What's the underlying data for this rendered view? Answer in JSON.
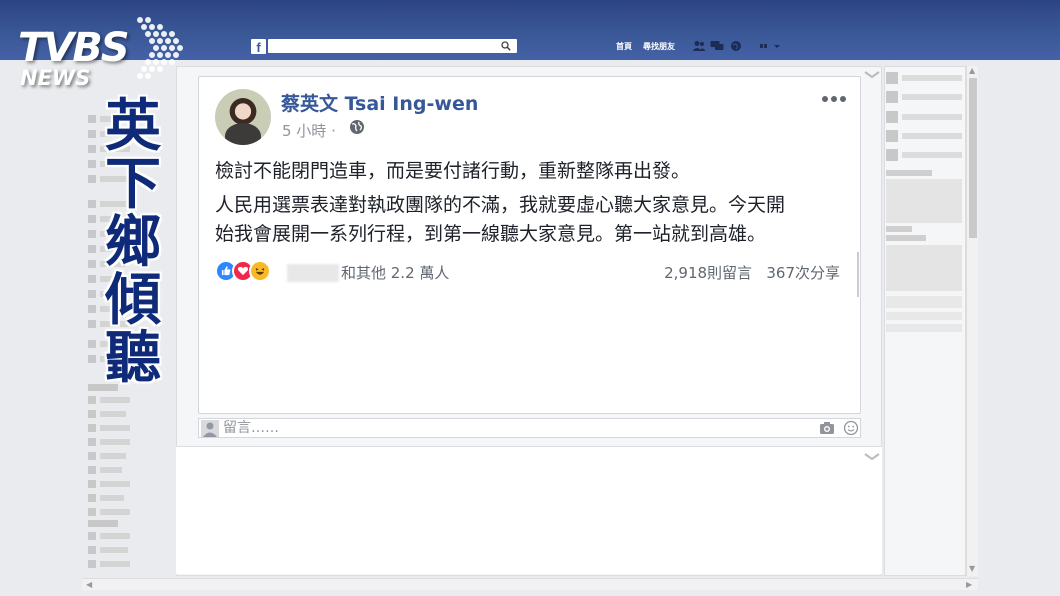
{
  "topbar": {
    "fb_logo": "f",
    "nav_home": "首頁",
    "nav_find_friends": "尋找朋友"
  },
  "overlay": {
    "logo_main": "TVBS",
    "logo_sub": "NEWS",
    "caption": "英下鄉傾聽"
  },
  "post": {
    "author": "蔡英文 Tsai Ing-wen",
    "time": "5 小時 ·",
    "paragraphs": [
      "檢討不能閉門造車，而是要付諸行動，重新整隊再出發。",
      "人民用選票表達對執政團隊的不滿，我就要虛心聽大家意見。今天開",
      "始我會展開一系列行程，到第一線聽大家意見。第一站就到高雄。"
    ],
    "reaction_summary": "和其他 2.2 萬人",
    "comments_count": "2,918則留言",
    "shares_count": "367次分享"
  },
  "comment_box": {
    "placeholder": "留言……"
  },
  "icons": {
    "globe": "globe-icon",
    "more": "more-options-icon",
    "like": "like-reaction-icon",
    "love": "love-reaction-icon",
    "haha": "haha-reaction-icon",
    "camera": "camera-icon",
    "emoji": "emoji-icon",
    "search": "search-icon"
  },
  "colors": {
    "topbar": "#3b5998",
    "author_link": "#365899",
    "caption": "#0e2a78",
    "like": "#2d88ff",
    "love": "#f0284a",
    "haha": "#f7b928"
  }
}
